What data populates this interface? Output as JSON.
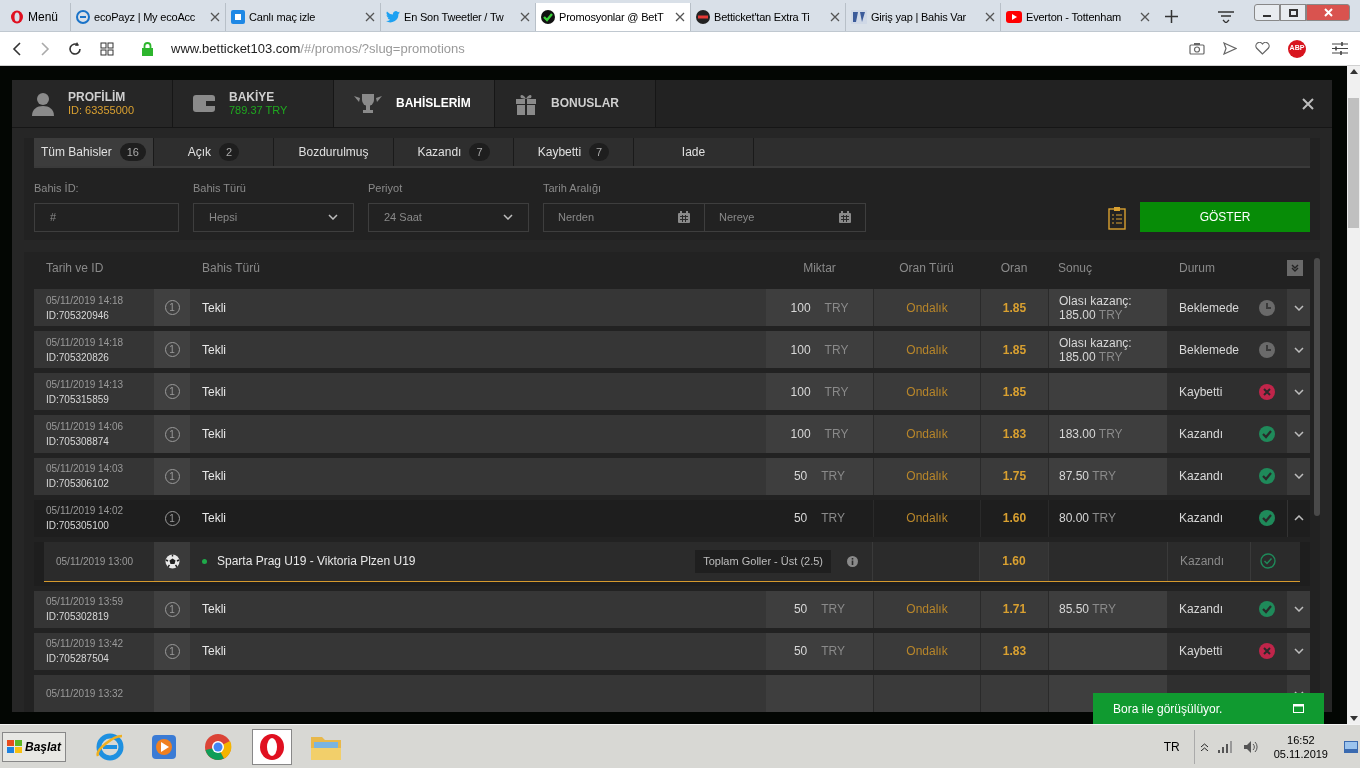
{
  "browser": {
    "menu_label": "Menü",
    "tabs": [
      {
        "title": "ecoPayz | My ecoAcc",
        "selected": false
      },
      {
        "title": "Canlı maç izle",
        "selected": false
      },
      {
        "title": "En Son Tweetler / Tw",
        "selected": false
      },
      {
        "title": "Promosyonlar @ BetT",
        "selected": true
      },
      {
        "title": "Betticket'tan Extra Ti",
        "selected": false
      },
      {
        "title": "Giriş yap | Bahis Var",
        "selected": false
      },
      {
        "title": "Everton - Tottenham",
        "selected": false
      }
    ],
    "url_host": "www.betticket103.com",
    "url_path": "/#/promos/?slug=promotions",
    "adblock_label": "ABP"
  },
  "account_tabs": [
    {
      "title": "PROFİLİM",
      "account_id": "ID: 63355000",
      "selected": false
    },
    {
      "title": "BAKİYE",
      "balance": "789.37 TRY",
      "selected": false
    },
    {
      "title": "BAHİSLERİM",
      "selected": true
    },
    {
      "title": "BONUSLAR",
      "selected": false
    }
  ],
  "bet_filter_tabs": [
    {
      "label": "Tüm Bahisler",
      "count": "16",
      "selected": true
    },
    {
      "label": "Açık",
      "count": "2",
      "selected": false
    },
    {
      "label": "Bozdurulmuş",
      "selected": false
    },
    {
      "label": "Kazandı",
      "count": "7",
      "selected": false
    },
    {
      "label": "Kaybetti",
      "count": "7",
      "selected": false
    },
    {
      "label": "Iade",
      "selected": false
    }
  ],
  "filters": {
    "bet_id_label": "Bahis İD:",
    "bet_id_placeholder": "#",
    "bet_type_label": "Bahis Türü",
    "bet_type_value": "Hepsi",
    "period_label": "Periyot",
    "period_value": "24 Saat",
    "date_range_label": "Tarih Aralığı",
    "from_placeholder": "Nerden",
    "to_placeholder": "Nereye",
    "show_button": "GÖSTER"
  },
  "table": {
    "columns": [
      "Tarih ve ID",
      "Bahis Türü",
      "Miktar",
      "Oran Türü",
      "Oran",
      "Sonuç",
      "Durum"
    ],
    "rows": [
      {
        "date": "05/11/2019 14:18",
        "id": "ID:705320946",
        "count": "1",
        "type": "Tekli",
        "amount": "100",
        "currency": "TRY",
        "odds_type": "Ondalık",
        "odds": "1.85",
        "result_label": "Olası kazanç:",
        "result_amount": "185.00",
        "result_currency": "TRY",
        "status": "Beklemede",
        "kind": "pending",
        "expanded": false
      },
      {
        "date": "05/11/2019 14:18",
        "id": "ID:705320826",
        "count": "1",
        "type": "Tekli",
        "amount": "100",
        "currency": "TRY",
        "odds_type": "Ondalık",
        "odds": "1.85",
        "result_label": "Olası kazanç:",
        "result_amount": "185.00",
        "result_currency": "TRY",
        "status": "Beklemede",
        "kind": "pending",
        "expanded": false
      },
      {
        "date": "05/11/2019 14:13",
        "id": "ID:705315859",
        "count": "1",
        "type": "Tekli",
        "amount": "100",
        "currency": "TRY",
        "odds_type": "Ondalık",
        "odds": "1.85",
        "status": "Kaybetti",
        "kind": "lost",
        "expanded": false
      },
      {
        "date": "05/11/2019 14:06",
        "id": "ID:705308874",
        "count": "1",
        "type": "Tekli",
        "amount": "100",
        "currency": "TRY",
        "odds_type": "Ondalık",
        "odds": "1.83",
        "result_amount": "183.00",
        "result_currency": "TRY",
        "status": "Kazandı",
        "kind": "won",
        "expanded": false
      },
      {
        "date": "05/11/2019 14:03",
        "id": "ID:705306102",
        "count": "1",
        "type": "Tekli",
        "amount": "50",
        "currency": "TRY",
        "odds_type": "Ondalık",
        "odds": "1.75",
        "result_amount": "87.50",
        "result_currency": "TRY",
        "status": "Kazandı",
        "kind": "won",
        "expanded": false
      },
      {
        "date": "05/11/2019 14:02",
        "id": "ID:705305100",
        "count": "1",
        "type": "Tekli",
        "amount": "50",
        "currency": "TRY",
        "odds_type": "Ondalık",
        "odds": "1.60",
        "result_amount": "80.00",
        "result_currency": "TRY",
        "status": "Kazandı",
        "kind": "won",
        "expanded": true,
        "selections": [
          {
            "date": "05/11/2019 13:00",
            "event": "Sparta Prag U19 - Viktoria Plzen U19",
            "market": "Toplam Goller - Üst (2.5)",
            "odds": "1.60",
            "status": "Kazandı",
            "kind": "won"
          }
        ]
      },
      {
        "date": "05/11/2019 13:59",
        "id": "ID:705302819",
        "count": "1",
        "type": "Tekli",
        "amount": "50",
        "currency": "TRY",
        "odds_type": "Ondalık",
        "odds": "1.71",
        "result_amount": "85.50",
        "result_currency": "TRY",
        "status": "Kazandı",
        "kind": "won",
        "expanded": false
      },
      {
        "date": "05/11/2019 13:42",
        "id": "ID:705287504",
        "count": "1",
        "type": "Tekli",
        "amount": "50",
        "currency": "TRY",
        "odds_type": "Ondalık",
        "odds": "1.83",
        "status": "Kaybetti",
        "kind": "lost",
        "expanded": false
      },
      {
        "date": "05/11/2019 13:32",
        "expanded": false
      }
    ]
  },
  "chat": {
    "label": "Bora ile görüşülüyor."
  },
  "taskbar": {
    "start_label": "Başlat",
    "apps": [
      {
        "selected": false
      },
      {
        "selected": false
      },
      {
        "selected": false
      },
      {
        "selected": true
      },
      {
        "selected": false
      }
    ],
    "language": "TR",
    "time": "16:52",
    "date": "05.11.2019"
  }
}
